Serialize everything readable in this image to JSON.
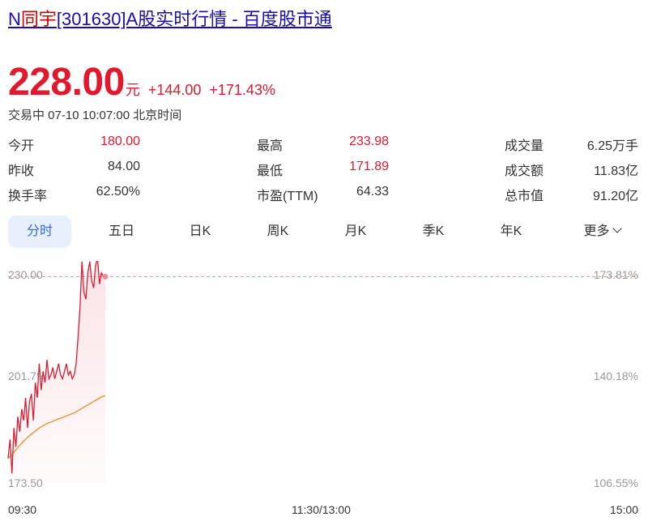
{
  "page_title": {
    "prefix": "N",
    "highlight": "同宇",
    "suffix": "[301630]A股实时行情 - 百度股市通"
  },
  "quote": {
    "price": "228.00",
    "unit": "元",
    "change": "+144.00",
    "change_pct": "+171.43%",
    "status": "交易中 07-10 10:07:00 北京时间"
  },
  "stats": [
    {
      "label": "今开",
      "value": "180.00",
      "color": "#e0192e"
    },
    {
      "label": "昨收",
      "value": "84.00",
      "color": "#333333"
    },
    {
      "label": "换手率",
      "value": "62.50%",
      "color": "#333333"
    },
    {
      "label": "最高",
      "value": "233.98",
      "color": "#e0192e"
    },
    {
      "label": "最低",
      "value": "171.89",
      "color": "#e0192e"
    },
    {
      "label": "市盈(TTM)",
      "value": "64.33",
      "color": "#333333"
    },
    {
      "label": "成交量",
      "value": "6.25万手",
      "color": "#333333"
    },
    {
      "label": "成交额",
      "value": "11.83亿",
      "color": "#333333"
    },
    {
      "label": "总市值",
      "value": "91.20亿",
      "color": "#333333"
    }
  ],
  "tabs": [
    {
      "label": "分时",
      "active": true
    },
    {
      "label": "五日",
      "active": false
    },
    {
      "label": "日K",
      "active": false
    },
    {
      "label": "周K",
      "active": false
    },
    {
      "label": "月K",
      "active": false
    },
    {
      "label": "季K",
      "active": false
    },
    {
      "label": "年K",
      "active": false
    },
    {
      "label": "更多",
      "active": false,
      "icon": "chevron-down-icon"
    }
  ],
  "chart_data": {
    "type": "line",
    "y_ticks_left": [
      "230.00",
      "201.75",
      "173.50"
    ],
    "y_ticks_right": [
      "173.81%",
      "140.18%",
      "106.55%"
    ],
    "x_ticks": [
      "09:30",
      "11:30/13:00",
      "15:00"
    ],
    "ylim": [
      173.5,
      230.0
    ],
    "reference_price": 228.0,
    "colors": {
      "price": "#e0192e",
      "avg": "#f08a24",
      "ref": "#f08a9a",
      "fill": "#fbe3e6"
    },
    "series": [
      {
        "values": [
          180,
          185,
          176,
          188,
          183,
          191,
          187,
          193,
          190,
          196,
          188,
          195,
          197,
          190,
          200,
          196,
          205,
          198,
          203,
          200,
          206,
          201,
          202,
          204,
          201,
          203,
          205,
          202,
          201,
          203,
          205,
          202,
          203,
          201,
          202,
          205,
          212,
          220,
          232,
          224,
          222,
          229,
          232,
          227,
          225,
          231,
          233,
          226,
          229,
          228,
          228
        ]
      },
      {
        "values": [
          180,
          180.5,
          181,
          181.6,
          182.2,
          182.8,
          183.4,
          184,
          184.5,
          185,
          185.5,
          186,
          186.4,
          186.8,
          187.2,
          187.6,
          188,
          188.3,
          188.6,
          188.9,
          189.2,
          189.4,
          189.6,
          189.8,
          190,
          190.2,
          190.4,
          190.6,
          190.8,
          191,
          191.2,
          191.4,
          191.6,
          191.8,
          192,
          192.3,
          192.6,
          192.9,
          193.2,
          193.5,
          193.8,
          194.1,
          194.4,
          194.7,
          195,
          195.3,
          195.6,
          195.9,
          196.2,
          196.4,
          196.5
        ]
      }
    ]
  }
}
